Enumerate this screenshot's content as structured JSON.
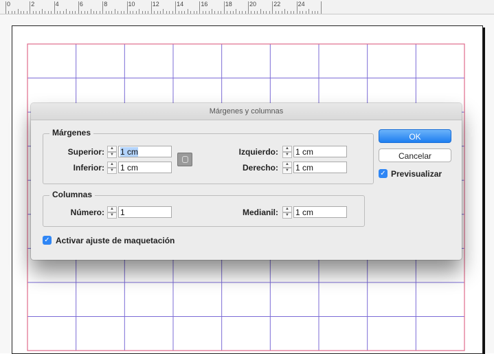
{
  "ruler": {
    "labels": [
      "0",
      "2",
      "4",
      "6",
      "8",
      "10",
      "12",
      "14",
      "16",
      "18",
      "20",
      "22",
      "24"
    ]
  },
  "colors": {
    "margin_guide": "#e06b8b",
    "column_guide": "#7b6bd6",
    "ok_button": "#1e7ef0",
    "checkbox": "#2f86f5"
  },
  "dialog": {
    "title": "Márgenes y columnas",
    "margins": {
      "legend": "Márgenes",
      "top_label": "Superior:",
      "top_value": "1 cm",
      "bottom_label": "Inferior:",
      "bottom_value": "1 cm",
      "left_label": "Izquierdo:",
      "left_value": "1 cm",
      "right_label": "Derecho:",
      "right_value": "1 cm",
      "chain_icon": "chain-link-icon"
    },
    "columns": {
      "legend": "Columnas",
      "number_label": "Número:",
      "number_value": "1",
      "gutter_label": "Medianil:",
      "gutter_value": "1 cm"
    },
    "layout_adjust_label": "Activar ajuste de maquetación",
    "layout_adjust_checked": true,
    "ok_label": "OK",
    "cancel_label": "Cancelar",
    "preview_label": "Previsualizar",
    "preview_checked": true
  }
}
